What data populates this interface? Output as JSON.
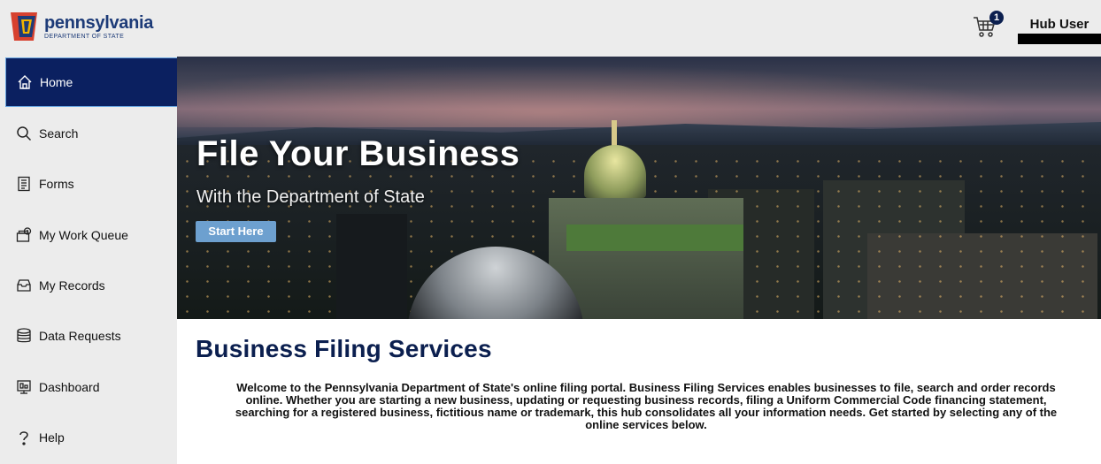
{
  "brand": {
    "name": "pennsylvania",
    "subtitle": "DEPARTMENT OF STATE"
  },
  "header": {
    "cart_count": "1",
    "user_name": "Hub User"
  },
  "sidebar": {
    "items": [
      {
        "label": "Home",
        "icon": "home-icon",
        "active": true
      },
      {
        "label": "Search",
        "icon": "search-icon"
      },
      {
        "label": "Forms",
        "icon": "forms-icon"
      },
      {
        "label": "My Work Queue",
        "icon": "work-queue-icon"
      },
      {
        "label": "My Records",
        "icon": "records-icon"
      },
      {
        "label": "Data Requests",
        "icon": "data-requests-icon"
      },
      {
        "label": "Dashboard",
        "icon": "dashboard-icon"
      },
      {
        "label": "Help",
        "icon": "help-icon"
      }
    ]
  },
  "hero": {
    "title": "File Your Business",
    "subtitle": "With the Department of State",
    "cta": "Start Here"
  },
  "main": {
    "title": "Business Filing Services",
    "intro": "Welcome to the Pennsylvania Department of State's online filing portal. Business Filing Services enables businesses to file, search and order records online. Whether you are starting a new business, updating or requesting business records, filing a Uniform Commercial Code financing statement, searching for a registered business, fictitious name or trademark, this hub consolidates all your information needs. Get started by selecting any of the online services below."
  },
  "colors": {
    "navy": "#0b2060",
    "accent": "#6da0cf",
    "sidebar_bg": "#ececec"
  }
}
